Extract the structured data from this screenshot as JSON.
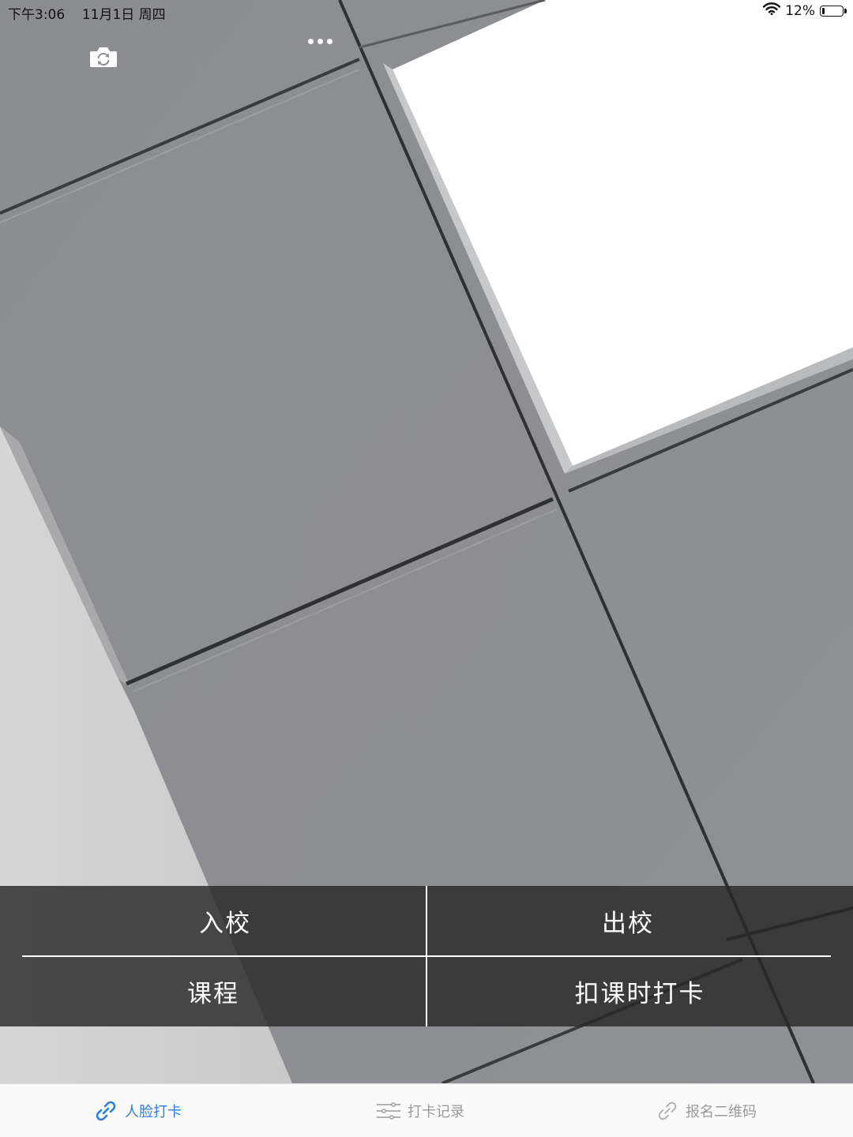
{
  "status_bar": {
    "time": "下午3:06",
    "date": "11月1日 周四",
    "battery_text": "12%",
    "battery_level": 0.12
  },
  "top_controls": {
    "camera_switch_icon": "camera-switch-icon",
    "more_icon": "more-horizontal-icon"
  },
  "actions": {
    "enter_school": "入校",
    "leave_school": "出校",
    "course": "课程",
    "deduct_checkin": "扣课时打卡"
  },
  "tabs": [
    {
      "label": "人脸打卡",
      "icon": "link-icon",
      "active": true
    },
    {
      "label": "打卡记录",
      "icon": "sliders-icon",
      "active": false
    },
    {
      "label": "报名二维码",
      "icon": "link-icon",
      "active": false
    }
  ],
  "colors": {
    "tab_active": "#2f7fd6",
    "tab_inactive": "#9a9a9a",
    "panel_background": "rgba(40,40,40,0.82)"
  }
}
